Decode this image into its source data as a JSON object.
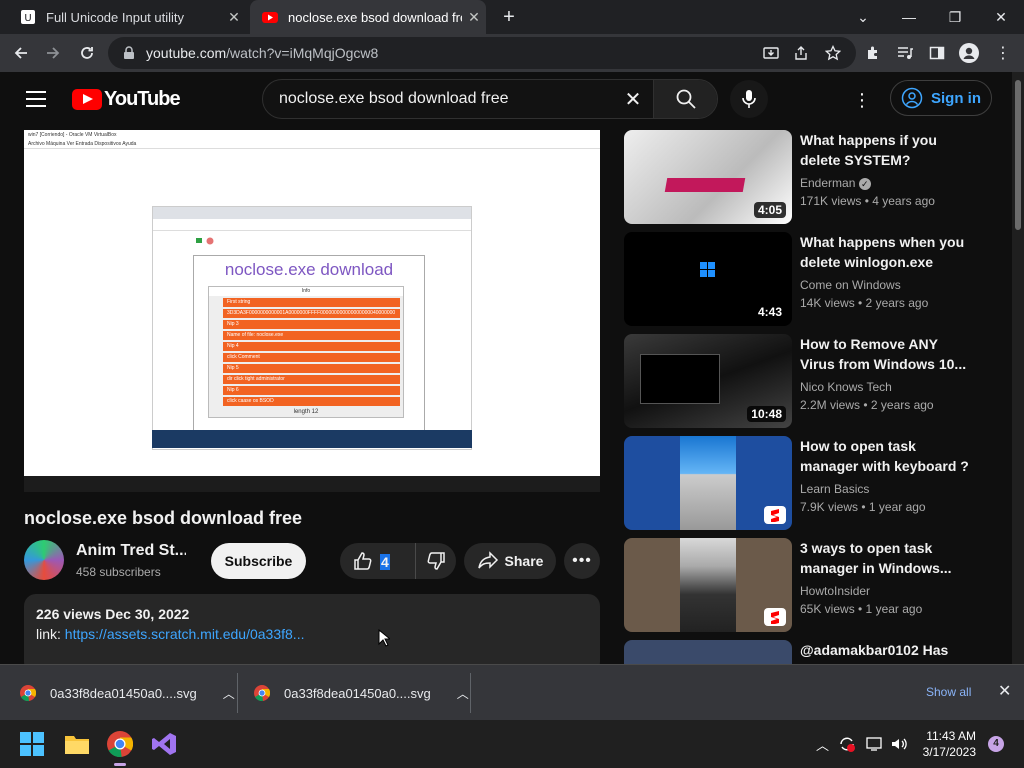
{
  "browser": {
    "tabs": [
      {
        "title": "Full Unicode Input utility",
        "active": false
      },
      {
        "title": "noclose.exe bsod download free",
        "active": true
      }
    ],
    "url_host": "youtube.com",
    "url_path": "/watch?v=iMqMqjOgcw8"
  },
  "header": {
    "logo_text": "YouTube",
    "search_query": "noclose.exe bsod download free",
    "signin_label": "Sign in"
  },
  "video": {
    "title": "noclose.exe bsod download free",
    "channel": "Anim Tred St...",
    "subscribers": "458 subscribers",
    "subscribe_label": "Subscribe",
    "likes": "4",
    "share_label": "Share",
    "views_date": "226 views  Dec 30, 2022",
    "link_label": "link: ",
    "link_url": "https://assets.scratch.mit.edu/0a33f8...",
    "embedded": {
      "vm_title": "win7 [Corriendo] - Oracle VM VirtualBox",
      "vm_menu": "Archivo   Máquina   Ver   Entrada   Dispositivos   Ayuda",
      "stage_title": "noclose.exe download",
      "list_rows": [
        "Info",
        "First string",
        "3D3DA3F0000000000001A0000000FFFF000000000000000000040000000",
        "Nip 3",
        "Name of file: noclose.exe",
        "Nip 4",
        "click Comment",
        "Nip 5",
        "dir click tight administrator",
        "Nip 6",
        "click caase os BSOD"
      ],
      "list_length": "length 12"
    }
  },
  "recommendations": [
    {
      "title": "What happens if you delete SYSTEM?",
      "channel": "Enderman",
      "verified": true,
      "meta": "171K views • 4 years ago",
      "duration": "4:05",
      "short": false,
      "thumb_color": "#d8d8d8"
    },
    {
      "title": "What happens when you delete winlogon.exe",
      "channel": "Come on Windows",
      "verified": false,
      "meta": "14K views • 2 years ago",
      "duration": "4:43",
      "short": false,
      "thumb_color": "#000000"
    },
    {
      "title": "How to Remove ANY Virus from Windows 10...",
      "channel": "Nico Knows Tech",
      "verified": false,
      "meta": "2.2M views • 2 years ago",
      "duration": "10:48",
      "short": false,
      "thumb_color": "#2a2a2a"
    },
    {
      "title": "How to open task manager with keyboard ?",
      "channel": "Learn Basics",
      "verified": false,
      "meta": "7.9K views • 1 year ago",
      "duration": "",
      "short": true,
      "thumb_color": "#1e4ea0"
    },
    {
      "title": "3 ways to open task manager in Windows...",
      "channel": "HowtoInsider",
      "verified": false,
      "meta": "65K views • 1 year ago",
      "duration": "",
      "short": true,
      "thumb_color": "#6b5a4a"
    },
    {
      "title": "@adamakbar0102 Has",
      "channel": "",
      "verified": false,
      "meta": "",
      "duration": "",
      "short": false,
      "thumb_color": "#3a4a6a"
    }
  ],
  "downloads": {
    "items": [
      "0a33f8dea01450a0....svg",
      "0a33f8dea01450a0....svg"
    ],
    "show_all_label": "Show all"
  },
  "taskbar": {
    "time": "11:43 AM",
    "date": "3/17/2023",
    "notifications": "4"
  }
}
